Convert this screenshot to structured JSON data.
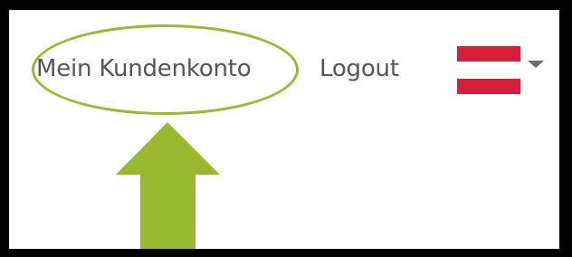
{
  "nav": {
    "account_label": "Mein Kundenkonto",
    "logout_label": "Logout"
  },
  "language_selector": {
    "flag": "austria-flag",
    "icon": "chevron-down-icon"
  },
  "annotation": {
    "highlight_color": "#98b930",
    "arrow_color": "#98b930"
  },
  "colors": {
    "background": "#ffffff",
    "border": "#000000",
    "text": "#555555",
    "flag_red": "#d61f3b"
  }
}
